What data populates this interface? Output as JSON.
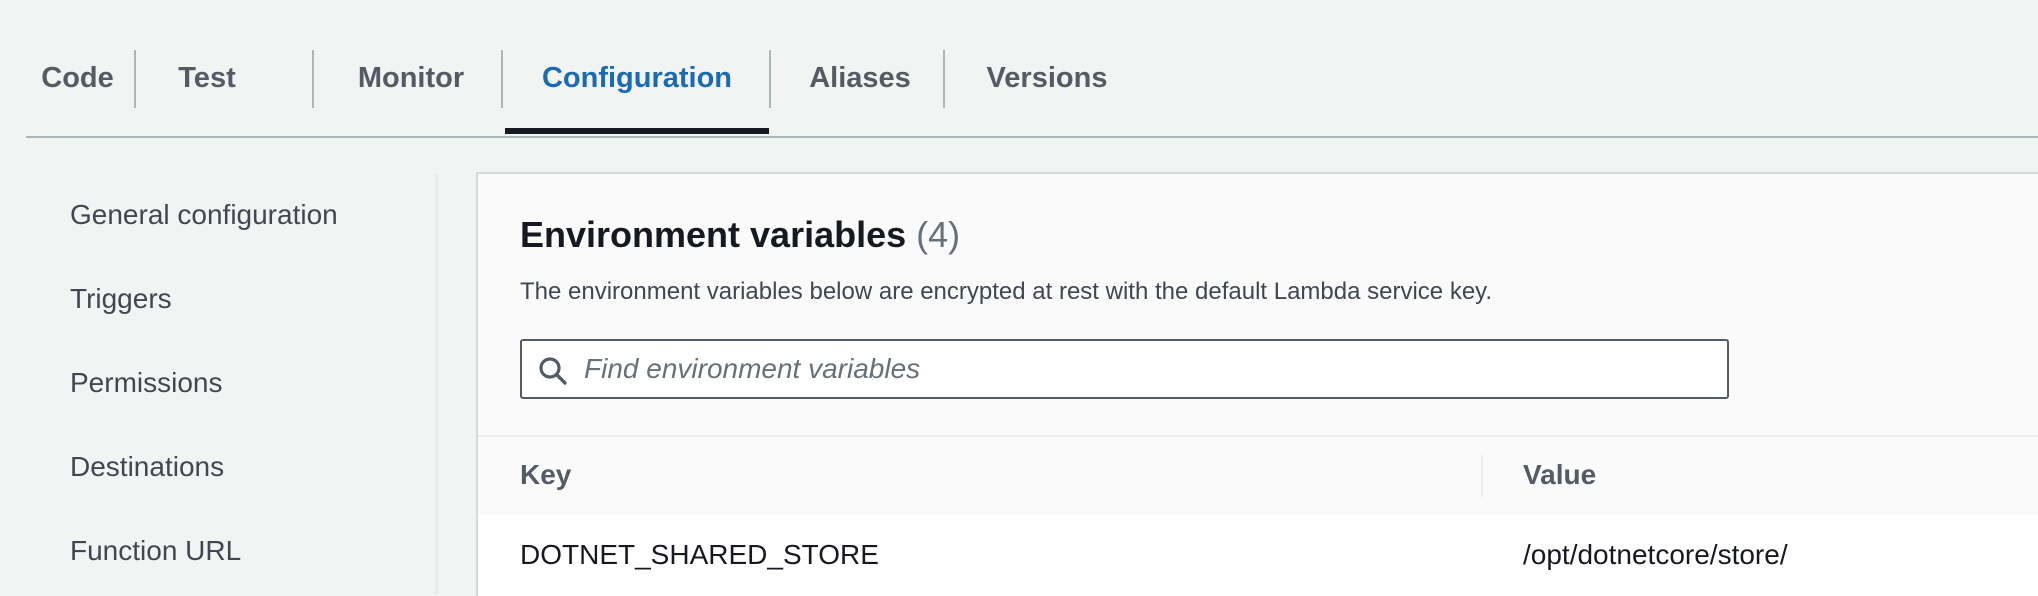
{
  "tabs": [
    {
      "label": "Code"
    },
    {
      "label": "Test"
    },
    {
      "label": "Monitor"
    },
    {
      "label": "Configuration",
      "active": true
    },
    {
      "label": "Aliases"
    },
    {
      "label": "Versions"
    }
  ],
  "sidebar": {
    "items": [
      {
        "label": "General configuration"
      },
      {
        "label": "Triggers"
      },
      {
        "label": "Permissions"
      },
      {
        "label": "Destinations"
      },
      {
        "label": "Function URL"
      }
    ]
  },
  "env": {
    "title": "Environment variables",
    "count": "(4)",
    "description": "The environment variables below are encrypted at rest with the default Lambda service key.",
    "search_placeholder": "Find environment variables",
    "search_value": "",
    "columns": {
      "key": "Key",
      "value": "Value"
    },
    "rows": [
      {
        "key": "DOTNET_SHARED_STORE",
        "value": "/opt/dotnetcore/store/"
      }
    ]
  },
  "icons": {
    "search": "search-icon"
  },
  "colors": {
    "active_tab": "#1b6bb4",
    "background": "#f2f3f3",
    "panel": "#fafafa"
  }
}
